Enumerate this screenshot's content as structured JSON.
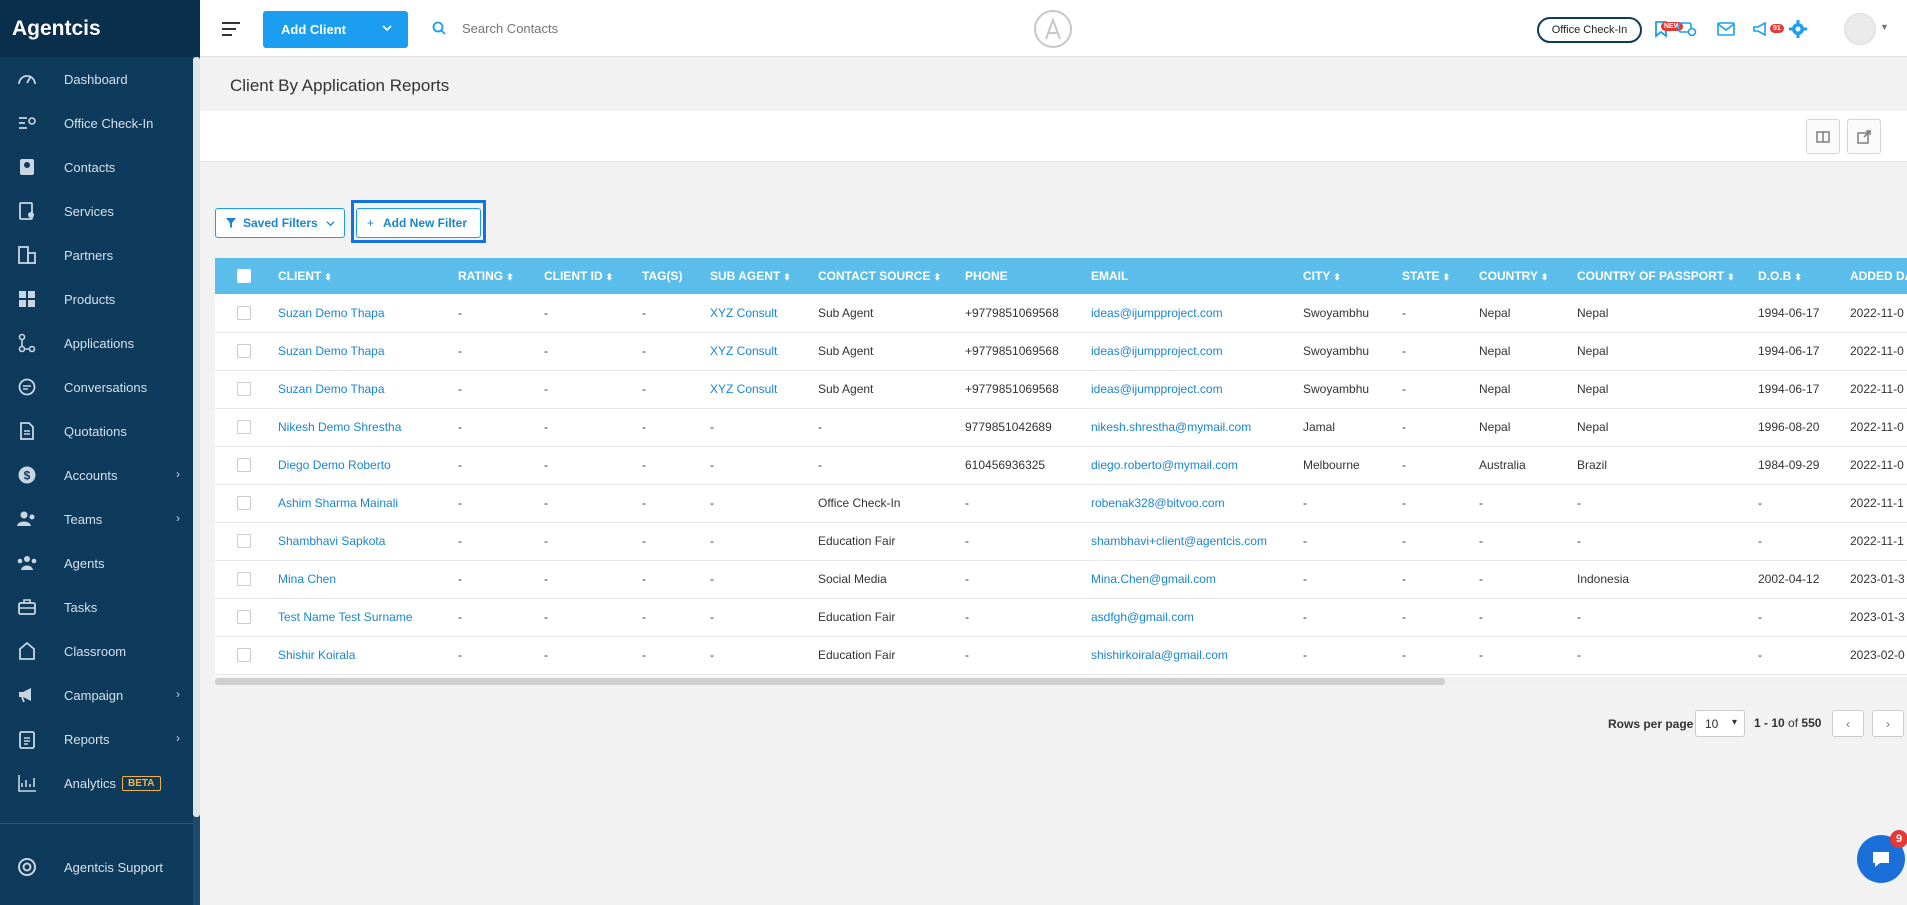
{
  "app": {
    "brand": "Agentcis"
  },
  "sidebar": {
    "items": [
      {
        "label": "Dashboard",
        "icon": "gauge-icon"
      },
      {
        "label": "Office Check-In",
        "icon": "checkin-icon"
      },
      {
        "label": "Contacts",
        "icon": "contact-card-icon"
      },
      {
        "label": "Services",
        "icon": "services-icon"
      },
      {
        "label": "Partners",
        "icon": "building-icon"
      },
      {
        "label": "Products",
        "icon": "products-icon"
      },
      {
        "label": "Applications",
        "icon": "flow-icon"
      },
      {
        "label": "Conversations",
        "icon": "chat-bubble-icon"
      },
      {
        "label": "Quotations",
        "icon": "document-icon"
      },
      {
        "label": "Accounts",
        "icon": "dollar-icon",
        "has_submenu": true
      },
      {
        "label": "Teams",
        "icon": "team-icon",
        "has_submenu": true
      },
      {
        "label": "Agents",
        "icon": "agents-icon"
      },
      {
        "label": "Tasks",
        "icon": "briefcase-icon"
      },
      {
        "label": "Classroom",
        "icon": "classroom-icon"
      },
      {
        "label": "Campaign",
        "icon": "megaphone-icon",
        "has_submenu": true
      },
      {
        "label": "Reports",
        "icon": "clipboard-icon",
        "has_submenu": true
      },
      {
        "label": "Analytics",
        "icon": "analytics-icon",
        "badge": "BETA"
      }
    ],
    "support": {
      "label": "Agentcis Support",
      "icon": "lifebuoy-icon"
    }
  },
  "topbar": {
    "add_client_label": "Add Client",
    "search_placeholder": "Search Contacts",
    "office_checkin_label": "Office Check-In",
    "new_badge": "NEW",
    "notification_count": "91"
  },
  "page": {
    "title": "Client By Application Reports"
  },
  "filters": {
    "saved_label": "Saved Filters",
    "add_label": "Add New Filter"
  },
  "table": {
    "headers": [
      "CLIENT",
      "RATING",
      "CLIENT ID",
      "TAG(S)",
      "SUB AGENT",
      "CONTACT SOURCE",
      "PHONE",
      "EMAIL",
      "CITY",
      "STATE",
      "COUNTRY",
      "COUNTRY OF PASSPORT",
      "D.O.B",
      "ADDED DA"
    ],
    "sortable": [
      true,
      true,
      true,
      false,
      true,
      true,
      false,
      false,
      true,
      true,
      true,
      true,
      true,
      false
    ],
    "rows": [
      [
        "Suzan Demo Thapa",
        "-",
        "-",
        "-",
        "XYZ Consult",
        "Sub Agent",
        "+9779851069568",
        "ideas@ijumpproject.com",
        "Swoyambhu",
        "-",
        "Nepal",
        "Nepal",
        "1994-06-17",
        "2022-11-0"
      ],
      [
        "Suzan Demo Thapa",
        "-",
        "-",
        "-",
        "XYZ Consult",
        "Sub Agent",
        "+9779851069568",
        "ideas@ijumpproject.com",
        "Swoyambhu",
        "-",
        "Nepal",
        "Nepal",
        "1994-06-17",
        "2022-11-0"
      ],
      [
        "Suzan Demo Thapa",
        "-",
        "-",
        "-",
        "XYZ Consult",
        "Sub Agent",
        "+9779851069568",
        "ideas@ijumpproject.com",
        "Swoyambhu",
        "-",
        "Nepal",
        "Nepal",
        "1994-06-17",
        "2022-11-0"
      ],
      [
        "Nikesh Demo Shrestha",
        "-",
        "-",
        "-",
        "-",
        "-",
        "9779851042689",
        "nikesh.shrestha@mymail.com",
        "Jamal",
        "-",
        "Nepal",
        "Nepal",
        "1996-08-20",
        "2022-11-0"
      ],
      [
        "Diego Demo Roberto",
        "-",
        "-",
        "-",
        "-",
        "-",
        "610456936325",
        "diego.roberto@mymail.com",
        "Melbourne",
        "-",
        "Australia",
        "Brazil",
        "1984-09-29",
        "2022-11-0"
      ],
      [
        "Ashim Sharma Mainali",
        "-",
        "-",
        "-",
        "-",
        "Office Check-In",
        "-",
        "robenak328@bitvoo.com",
        "-",
        "-",
        "-",
        "-",
        "-",
        "2022-11-1"
      ],
      [
        "Shambhavi Sapkota",
        "-",
        "-",
        "-",
        "-",
        "Education Fair",
        "-",
        "shambhavi+client@agentcis.com",
        "-",
        "-",
        "-",
        "-",
        "-",
        "2022-11-1"
      ],
      [
        "Mina Chen",
        "-",
        "-",
        "-",
        "-",
        "Social Media",
        "-",
        "Mina.Chen@gmail.com",
        "-",
        "-",
        "-",
        "Indonesia",
        "2002-04-12",
        "2023-01-3"
      ],
      [
        "Test Name Test Surname",
        "-",
        "-",
        "-",
        "-",
        "Education Fair",
        "-",
        "asdfgh@gmail.com",
        "-",
        "-",
        "-",
        "-",
        "-",
        "2023-01-3"
      ],
      [
        "Shishir Koirala",
        "-",
        "-",
        "-",
        "-",
        "Education Fair",
        "-",
        "shishirkoirala@gmail.com",
        "-",
        "-",
        "-",
        "-",
        "-",
        "2023-02-0"
      ]
    ]
  },
  "pagination": {
    "rows_per_page_label": "Rows per page",
    "rows_per_page": "10",
    "range": "1 - 10",
    "of": "of",
    "total": "550"
  },
  "chat": {
    "badge": "9"
  }
}
